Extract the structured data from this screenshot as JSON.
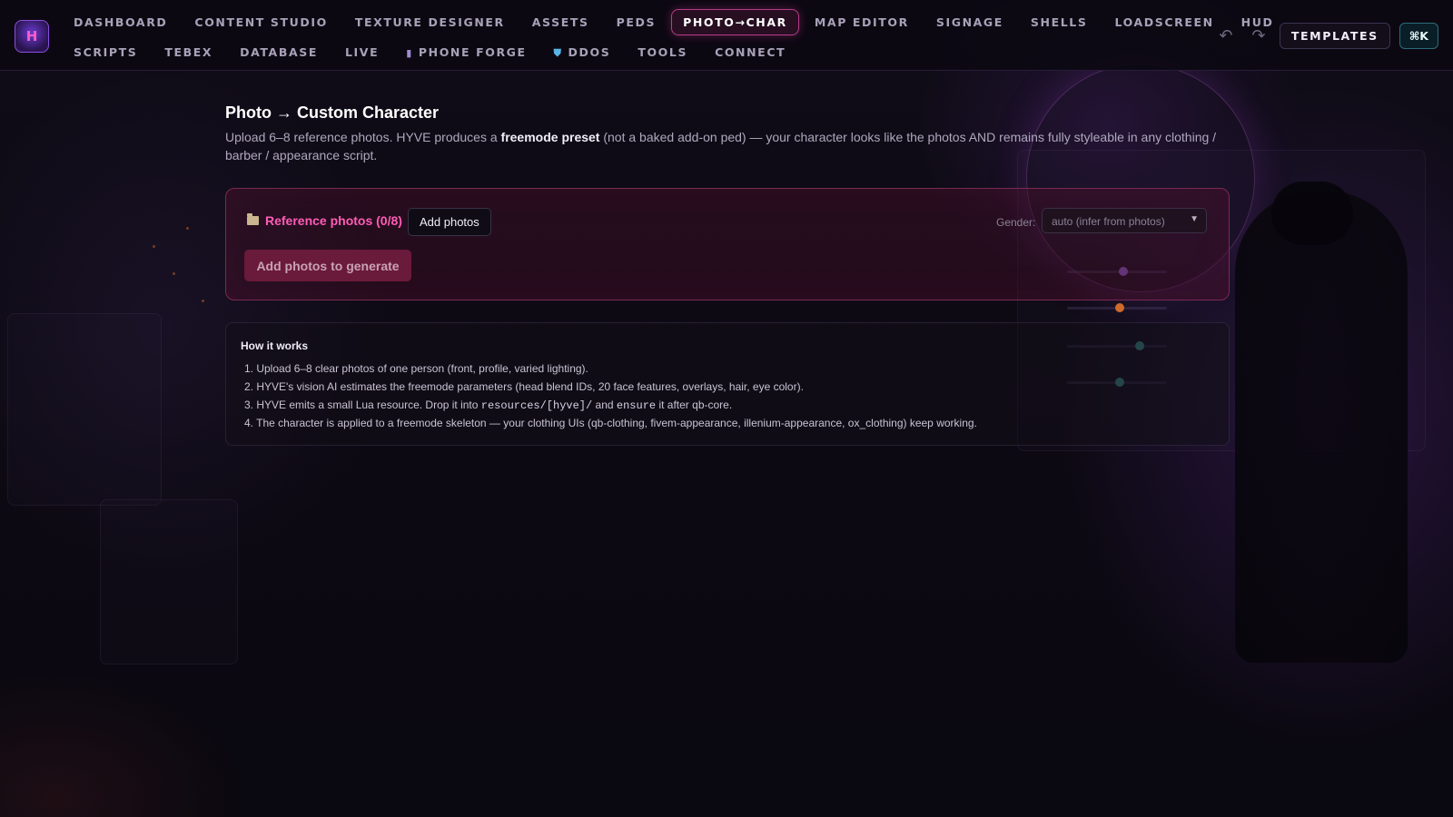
{
  "app": {
    "logo_text": "H"
  },
  "nav": {
    "row1": [
      {
        "label": "DASHBOARD",
        "icon": ""
      },
      {
        "label": "CONTENT STUDIO",
        "icon": ""
      },
      {
        "label": "TEXTURE DESIGNER",
        "icon": ""
      },
      {
        "label": "ASSETS",
        "icon": ""
      },
      {
        "label": "PEDS",
        "icon": ""
      },
      {
        "label": "PHOTO→CHAR",
        "icon": "",
        "active": true
      },
      {
        "label": "MAP EDITOR",
        "icon": ""
      },
      {
        "label": "SIGNAGE",
        "icon": ""
      },
      {
        "label": "SHELLS",
        "icon": ""
      },
      {
        "label": "LOADSCREEN",
        "icon": ""
      },
      {
        "label": "HUD",
        "icon": ""
      }
    ],
    "row2": [
      {
        "label": "SCRIPTS",
        "icon": ""
      },
      {
        "label": "TEBEX",
        "icon": ""
      },
      {
        "label": "DATABASE",
        "icon": ""
      },
      {
        "label": "LIVE",
        "icon": ""
      },
      {
        "label": "PHONE FORGE",
        "icon": "phone-icon"
      },
      {
        "label": "DDOS",
        "icon": "shield-icon"
      },
      {
        "label": "TOOLS",
        "icon": ""
      },
      {
        "label": "CONNECT",
        "icon": ""
      }
    ]
  },
  "toolbar": {
    "undo_icon": "undo-icon",
    "redo_icon": "redo-icon",
    "templates_label": "TEMPLATES",
    "command_label": "⌘K"
  },
  "page": {
    "title": "Photo → Custom Character",
    "desc_part1": "Upload 6–8 reference photos. HYVE produces a ",
    "desc_bold": "freemode preset",
    "desc_part2": " (not a baked add-on ped) — your character looks like the photos AND remains fully styleable in any clothing / barber / appearance script."
  },
  "upload": {
    "title": "Reference photos (0/8)",
    "icon": "folder-icon",
    "add_button": "Add photos",
    "gender_label": "Gender:",
    "gender_value": "auto (infer from photos)",
    "generate_button": "Add photos to generate"
  },
  "how": {
    "title": "How it works",
    "steps": [
      "1. Upload 6–8 clear photos of one person (front, profile, varied lighting).",
      "2. HYVE's vision AI estimates the freemode parameters (head blend IDs, 20 face features, overlays, hair, eye color).",
      {
        "before": "3. HYVE emits a small Lua resource. Drop it into ",
        "code": "resources/[hyve]/",
        "middle": " and ",
        "code2": "ensure",
        "after": " it after qb-core."
      },
      "4. The character is applied to a freemode skeleton — your clothing UIs (qb-clothing, fivem-appearance, illenium-appearance, ox_clothing) keep working."
    ]
  },
  "colors": {
    "accent": "#ff5cb6",
    "active_border": "#b43d8a",
    "card_border": "#7a2a52"
  }
}
